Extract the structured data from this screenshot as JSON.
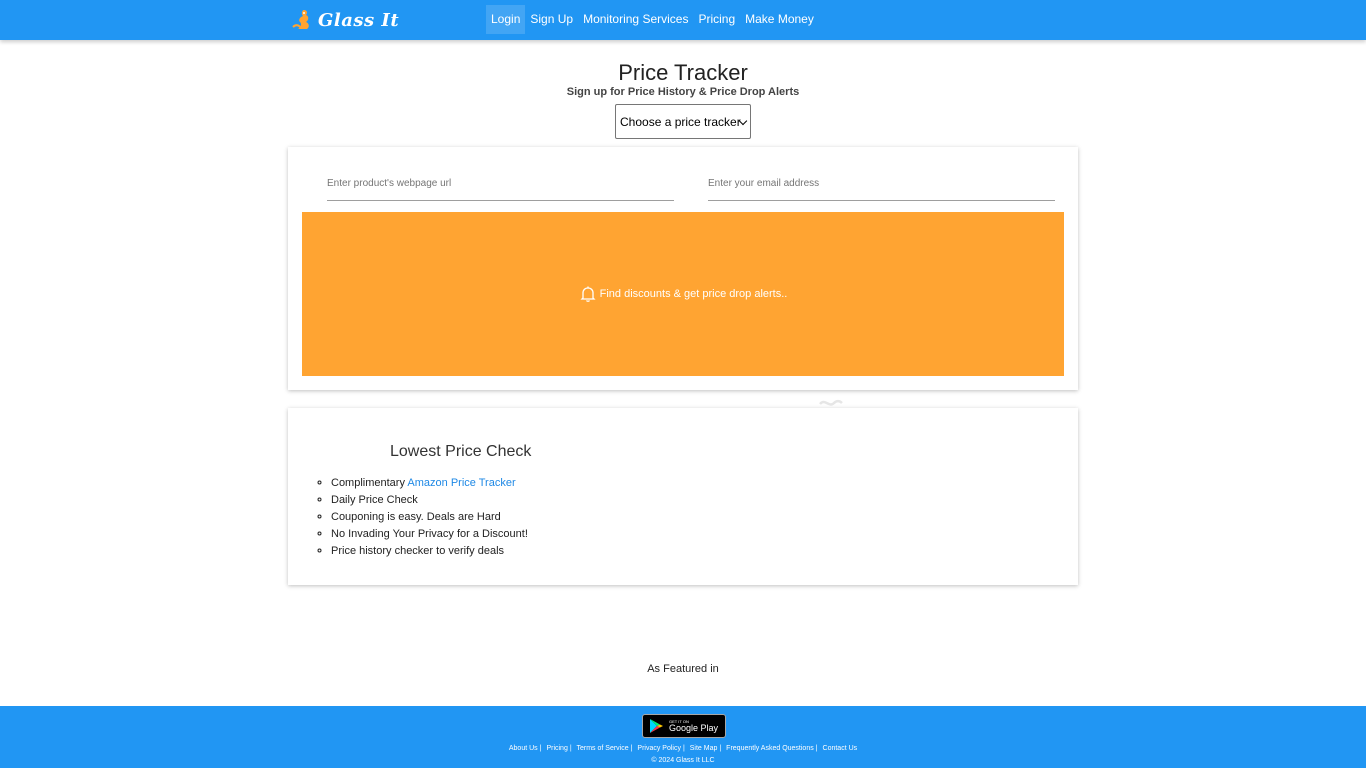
{
  "brand": {
    "name": "Glass It",
    "logo_icon": "genie-icon"
  },
  "nav": {
    "items": [
      {
        "label": "Login",
        "active": true
      },
      {
        "label": "Sign Up"
      },
      {
        "label": "Monitoring Services"
      },
      {
        "label": "Pricing"
      },
      {
        "label": "Make Money"
      }
    ]
  },
  "header": {
    "title": "Price Tracker",
    "subtitle": "Sign up for Price History & Price Drop Alerts",
    "select_value": "Choose a price tracker"
  },
  "form": {
    "url_placeholder": "Enter product's webpage url",
    "email_placeholder": "Enter your email address",
    "submit_label": "Find discounts & get price drop alerts..",
    "submit_icon": "bell-icon",
    "accent_color": "#ffa432"
  },
  "features": {
    "heading": "Lowest Price Check",
    "item1_prefix": "Complimentary ",
    "item1_link": "Amazon Price Tracker",
    "item2": "Daily Price Check",
    "item3": "Couponing is easy. Deals are Hard",
    "item4": "No Invading Your Privacy for a Discount!",
    "item5": "Price history checker to verify deals"
  },
  "featured_label": "As Featured in",
  "footer": {
    "badge_small": "GET IT ON",
    "badge_big": "Google Play",
    "links": [
      "About Us",
      "Pricing",
      "Terms of Service",
      "Privacy Policy",
      "Site Map",
      "Frequently Asked Questions",
      "Contact Us"
    ],
    "copyright": "© 2024 Glass It LLC",
    "color": "#2196f3"
  }
}
